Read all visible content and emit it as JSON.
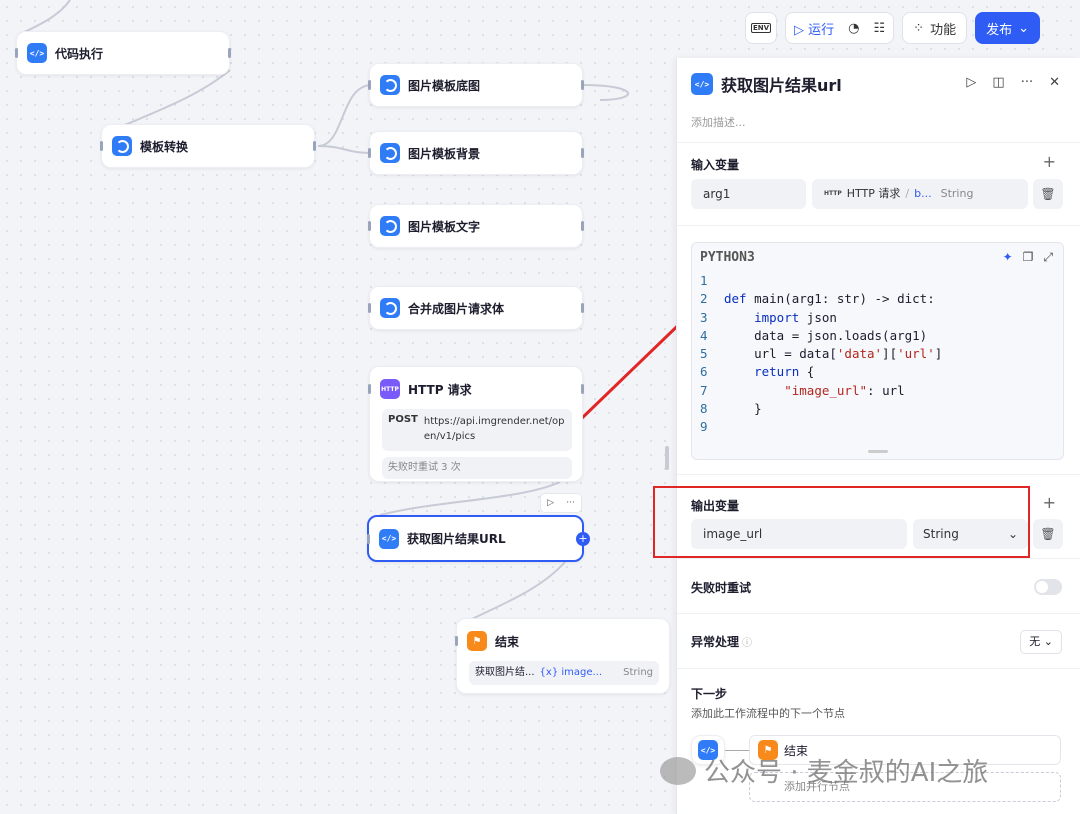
{
  "toolbar": {
    "env_label": "ENV",
    "run_label": "运行",
    "feature_label": "功能",
    "publish_label": "发布"
  },
  "canvas": {
    "nodes": {
      "code_exec": "代码执行",
      "template_convert": "模板转换",
      "tpl_base": "图片模板底图",
      "tpl_bg": "图片模板背景",
      "tpl_text": "图片模板文字",
      "merge_body": "合并成图片请求体",
      "http": {
        "title": "HTTP 请求",
        "method": "POST",
        "url": "https://api.imgrender.net/open/v1/pics",
        "retry": "失败时重试 3 次"
      },
      "get_url": "获取图片结果URL",
      "end": {
        "title": "结束",
        "var_source": "获取图片结...",
        "var_name": "{x} image...",
        "var_type": "String"
      }
    }
  },
  "panel": {
    "title": "获取图片结果url",
    "desc_placeholder": "添加描述...",
    "input_section": "输入变量",
    "input_var": {
      "name": "arg1",
      "ref_icon": "HTTP",
      "ref_node": "HTTP 请求",
      "ref_sep": "/",
      "ref_field": "b...",
      "ref_type": "String"
    },
    "code": {
      "lang": "PYTHON3",
      "lines": [
        {
          "n": "1",
          "t": ""
        },
        {
          "n": "2",
          "t": "def main(arg1: str) -> dict:"
        },
        {
          "n": "3",
          "t": "    import json"
        },
        {
          "n": "4",
          "t": "    data = json.loads(arg1)"
        },
        {
          "n": "5",
          "t": "    url = data['data']['url']"
        },
        {
          "n": "6",
          "t": "    return {"
        },
        {
          "n": "7",
          "t": "        \"image_url\": url"
        },
        {
          "n": "8",
          "t": "    }"
        },
        {
          "n": "9",
          "t": ""
        }
      ]
    },
    "output_section": "输出变量",
    "output_var": {
      "name": "image_url",
      "type": "String"
    },
    "retry_label": "失败时重试",
    "exception_label": "异常处理",
    "exception_value": "无",
    "next_step_title": "下一步",
    "next_step_sub": "添加此工作流程中的下一个节点",
    "next_node": "结束",
    "add_parallel": "添加并行节点"
  },
  "watermark": "公众号 · 麦金叔的AI之旅",
  "colors": {
    "accent": "#2f5cf5",
    "annotation": "#e12626",
    "http_icon": "#7a5af8",
    "end_icon": "#f88a1c"
  }
}
